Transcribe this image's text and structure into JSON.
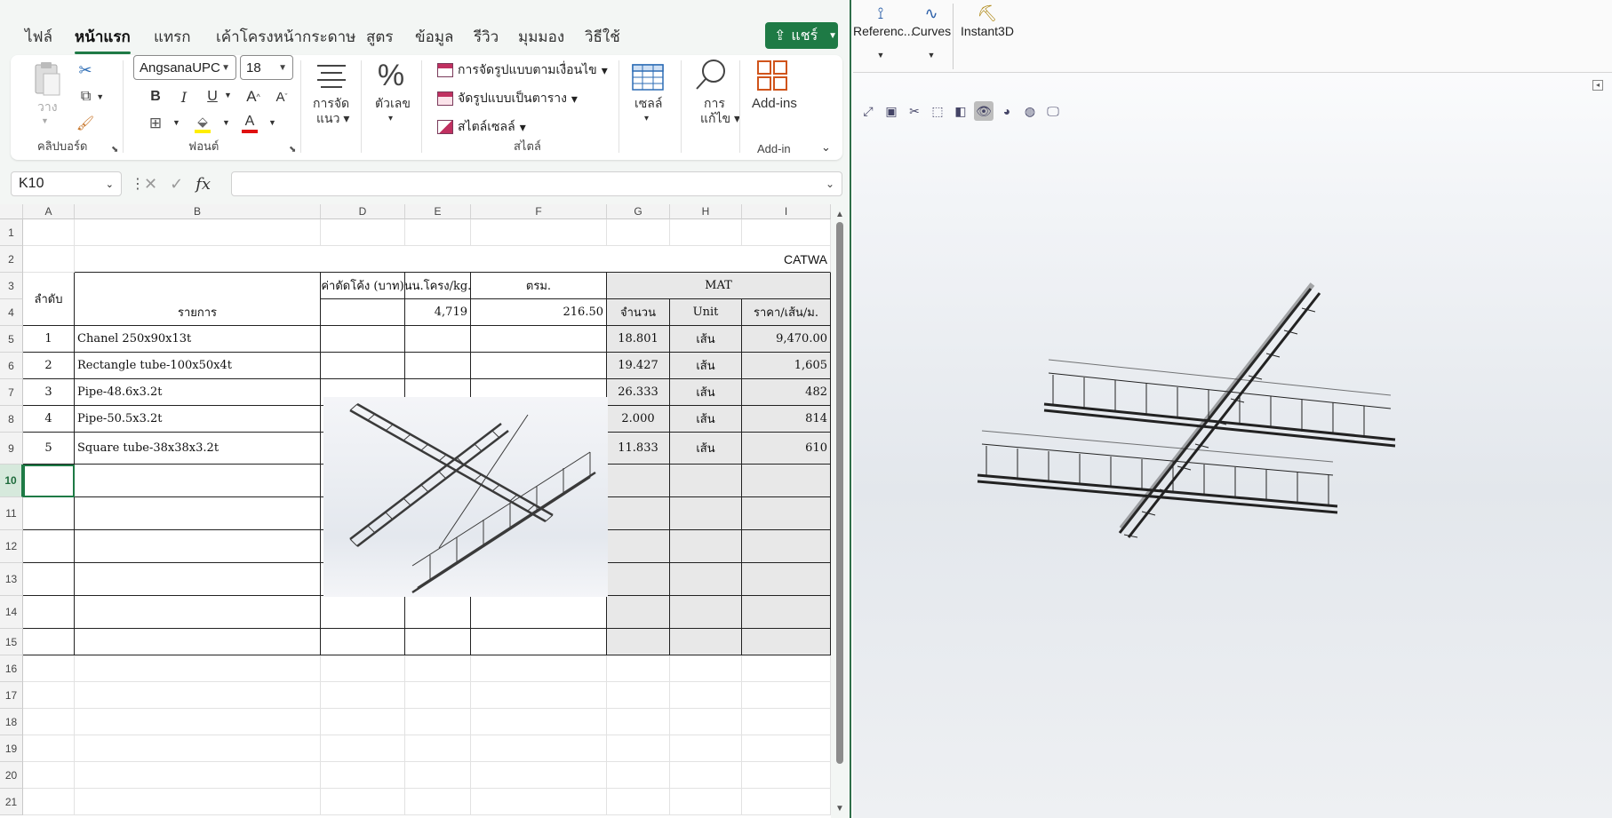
{
  "excel": {
    "tabs": [
      "ไฟล์",
      "หน้าแรก",
      "แทรก",
      "เค้าโครงหน้ากระดาษ",
      "สูตร",
      "ข้อมูล",
      "รีวิว",
      "มุมมอง",
      "วิธีใช้"
    ],
    "active_tab": "หน้าแรก",
    "share_label": "แชร์",
    "clipboard": {
      "paste_label": "วาง",
      "group_label": "คลิปบอร์ด"
    },
    "font": {
      "name": "AngsanaUPC",
      "size": "18",
      "bold": "B",
      "italic": "I",
      "underline": "U",
      "group_label": "ฟอนต์",
      "grow": "A",
      "shrink": "A",
      "color_letter": "A"
    },
    "alignment": {
      "label_line1": "การจัด",
      "label_line2": "แนว"
    },
    "number": {
      "label": "ตัวเลข",
      "symbol": "%"
    },
    "styles": {
      "items": [
        "การจัดรูปแบบตามเงื่อนไข",
        "จัดรูปแบบเป็นตาราง",
        "สไตล์เซลล์"
      ],
      "group_label": "สไตล์"
    },
    "cells_group": {
      "label": "เซลล์"
    },
    "editing": {
      "label_line1": "การ",
      "label_line2": "แก้ไข"
    },
    "addins": {
      "label": "Add-ins",
      "group_label": "Add-in"
    },
    "name_box": "K10",
    "fx": "fx",
    "columns": [
      "A",
      "B",
      "D",
      "E",
      "F",
      "G",
      "H",
      "I"
    ],
    "rows": [
      "1",
      "2",
      "3",
      "4",
      "5",
      "6",
      "7",
      "8",
      "9",
      "10",
      "11",
      "12",
      "13",
      "14",
      "15",
      "16",
      "17",
      "18",
      "19",
      "20",
      "21"
    ],
    "sheet": {
      "title_fragment": "CATWA",
      "h_order": "ลำดับ",
      "h_item": "รายการ",
      "h_bend": "ค่าดัดโค้ง (บาท)",
      "h_weight": "นน.โครง/kg.",
      "h_area": "ตรม.",
      "h_mat": "MAT",
      "h_qty": "จำนวน",
      "h_unit": "Unit",
      "h_price": "ราคา/เส้น/ม.",
      "weight_value": "4,719",
      "area_value": "216.50",
      "items": [
        {
          "no": "1",
          "name": "Chanel 250x90x13t",
          "qty": "18.801",
          "unit": "เส้น",
          "price": "9,470.00"
        },
        {
          "no": "2",
          "name": "Rectangle tube-100x50x4t",
          "qty": "19.427",
          "unit": "เส้น",
          "price": "1,605"
        },
        {
          "no": "3",
          "name": "Pipe-48.6x3.2t",
          "qty": "26.333",
          "unit": "เส้น",
          "price": "482"
        },
        {
          "no": "4",
          "name": "Pipe-50.5x3.2t",
          "qty": "2.000",
          "unit": "เส้น",
          "price": "814"
        },
        {
          "no": "5",
          "name": "Square tube-38x38x3.2t",
          "qty": "11.833",
          "unit": "เส้น",
          "price": "610"
        }
      ]
    }
  },
  "cad": {
    "tools": [
      "Referenc...",
      "Curves",
      "Instant3D"
    ]
  }
}
